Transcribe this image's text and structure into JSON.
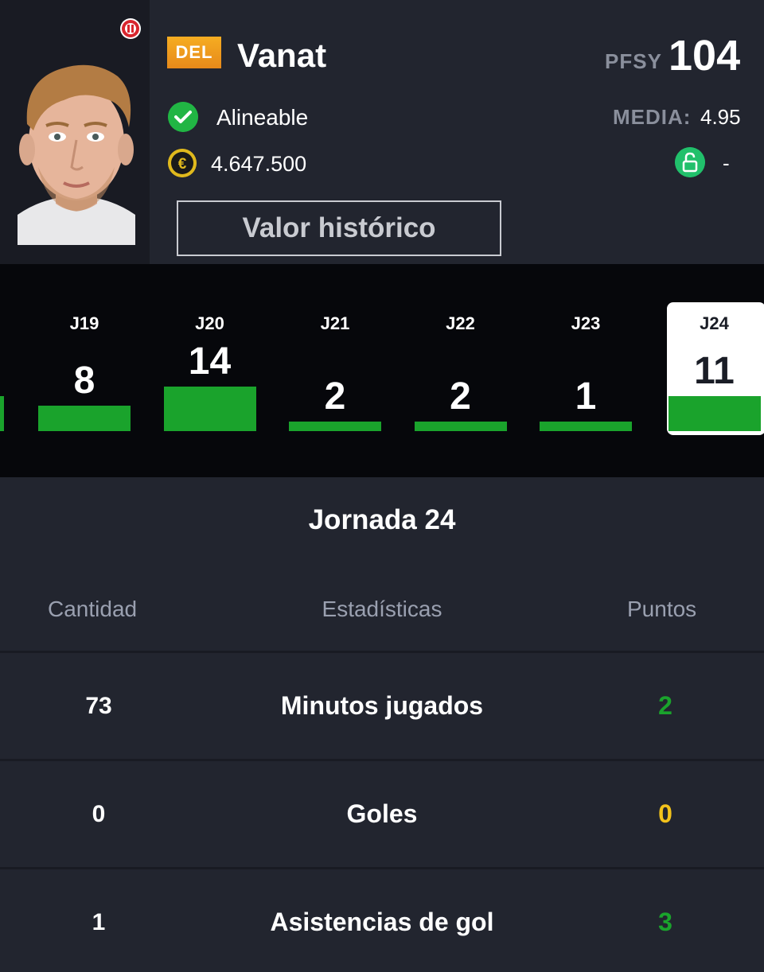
{
  "player": {
    "position": "DEL",
    "name": "Vanat",
    "status": "Alineable",
    "price": "4.647.500",
    "clause_value": "-"
  },
  "scores": {
    "pfsy_label": "PFSY",
    "pfsy_value": "104",
    "media_label": "MEDIA:",
    "media_value": "4.95"
  },
  "actions": {
    "history_button": "Valor histórico"
  },
  "colors": {
    "position_badge": "#f0a020",
    "positive_points": "#1aa32c",
    "zero_points": "#f2c21b",
    "status_ok": "#21b544",
    "coin": "#e0b91d",
    "lock": "#21c06b"
  },
  "icons": [
    "club-crest-icon",
    "check-icon",
    "euro-coin-icon",
    "unlock-icon"
  ],
  "rounds": [
    {
      "label": "J19",
      "points": "8"
    },
    {
      "label": "J20",
      "points": "14"
    },
    {
      "label": "J21",
      "points": "2"
    },
    {
      "label": "J22",
      "points": "2"
    },
    {
      "label": "J23",
      "points": "1"
    },
    {
      "label": "J24",
      "points": "11",
      "selected": true
    }
  ],
  "stats": {
    "title": "Jornada 24",
    "headers": {
      "quantity": "Cantidad",
      "stat": "Estadísticas",
      "points": "Puntos"
    },
    "rows": [
      {
        "quantity": "73",
        "name": "Minutos jugados",
        "points": "2",
        "color": "#1aa32c"
      },
      {
        "quantity": "0",
        "name": "Goles",
        "points": "0",
        "color": "#f2c21b"
      },
      {
        "quantity": "1",
        "name": "Asistencias de gol",
        "points": "3",
        "color": "#1aa32c"
      }
    ]
  }
}
